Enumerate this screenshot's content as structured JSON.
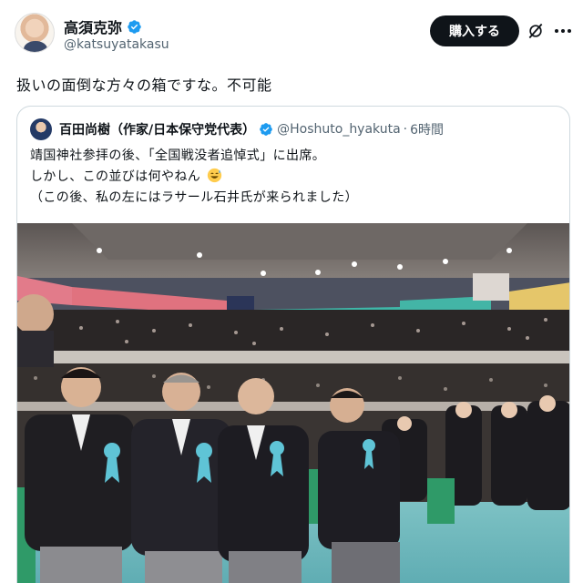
{
  "post": {
    "author_name": "高須克弥",
    "author_handle": "@katsuyatakasu",
    "buy_label": "購入する",
    "text": "扱いの面倒な方々の箱ですな。不可能"
  },
  "quoted": {
    "author_name": "百田尚樹（作家/日本保守党代表）",
    "author_handle": "@Hoshuto_hyakuta",
    "separator": "·",
    "time": "6時間",
    "line1": "靖国神社参拝の後、「全国戦没者追悼式」に出席。",
    "line2": "しかし、この並びは何やねん",
    "line3": "（この後、私の左にはラサール石井氏が来られました）"
  },
  "icons": {
    "verified": "verified-badge-icon",
    "grok": "grok-icon",
    "more": "more-icon",
    "emoji": "sweat-smile-emoji-icon"
  },
  "colors": {
    "verified_blue": "#1d9bf0",
    "text": "#0f1419",
    "muted": "#536471",
    "border": "#cfd9de"
  }
}
